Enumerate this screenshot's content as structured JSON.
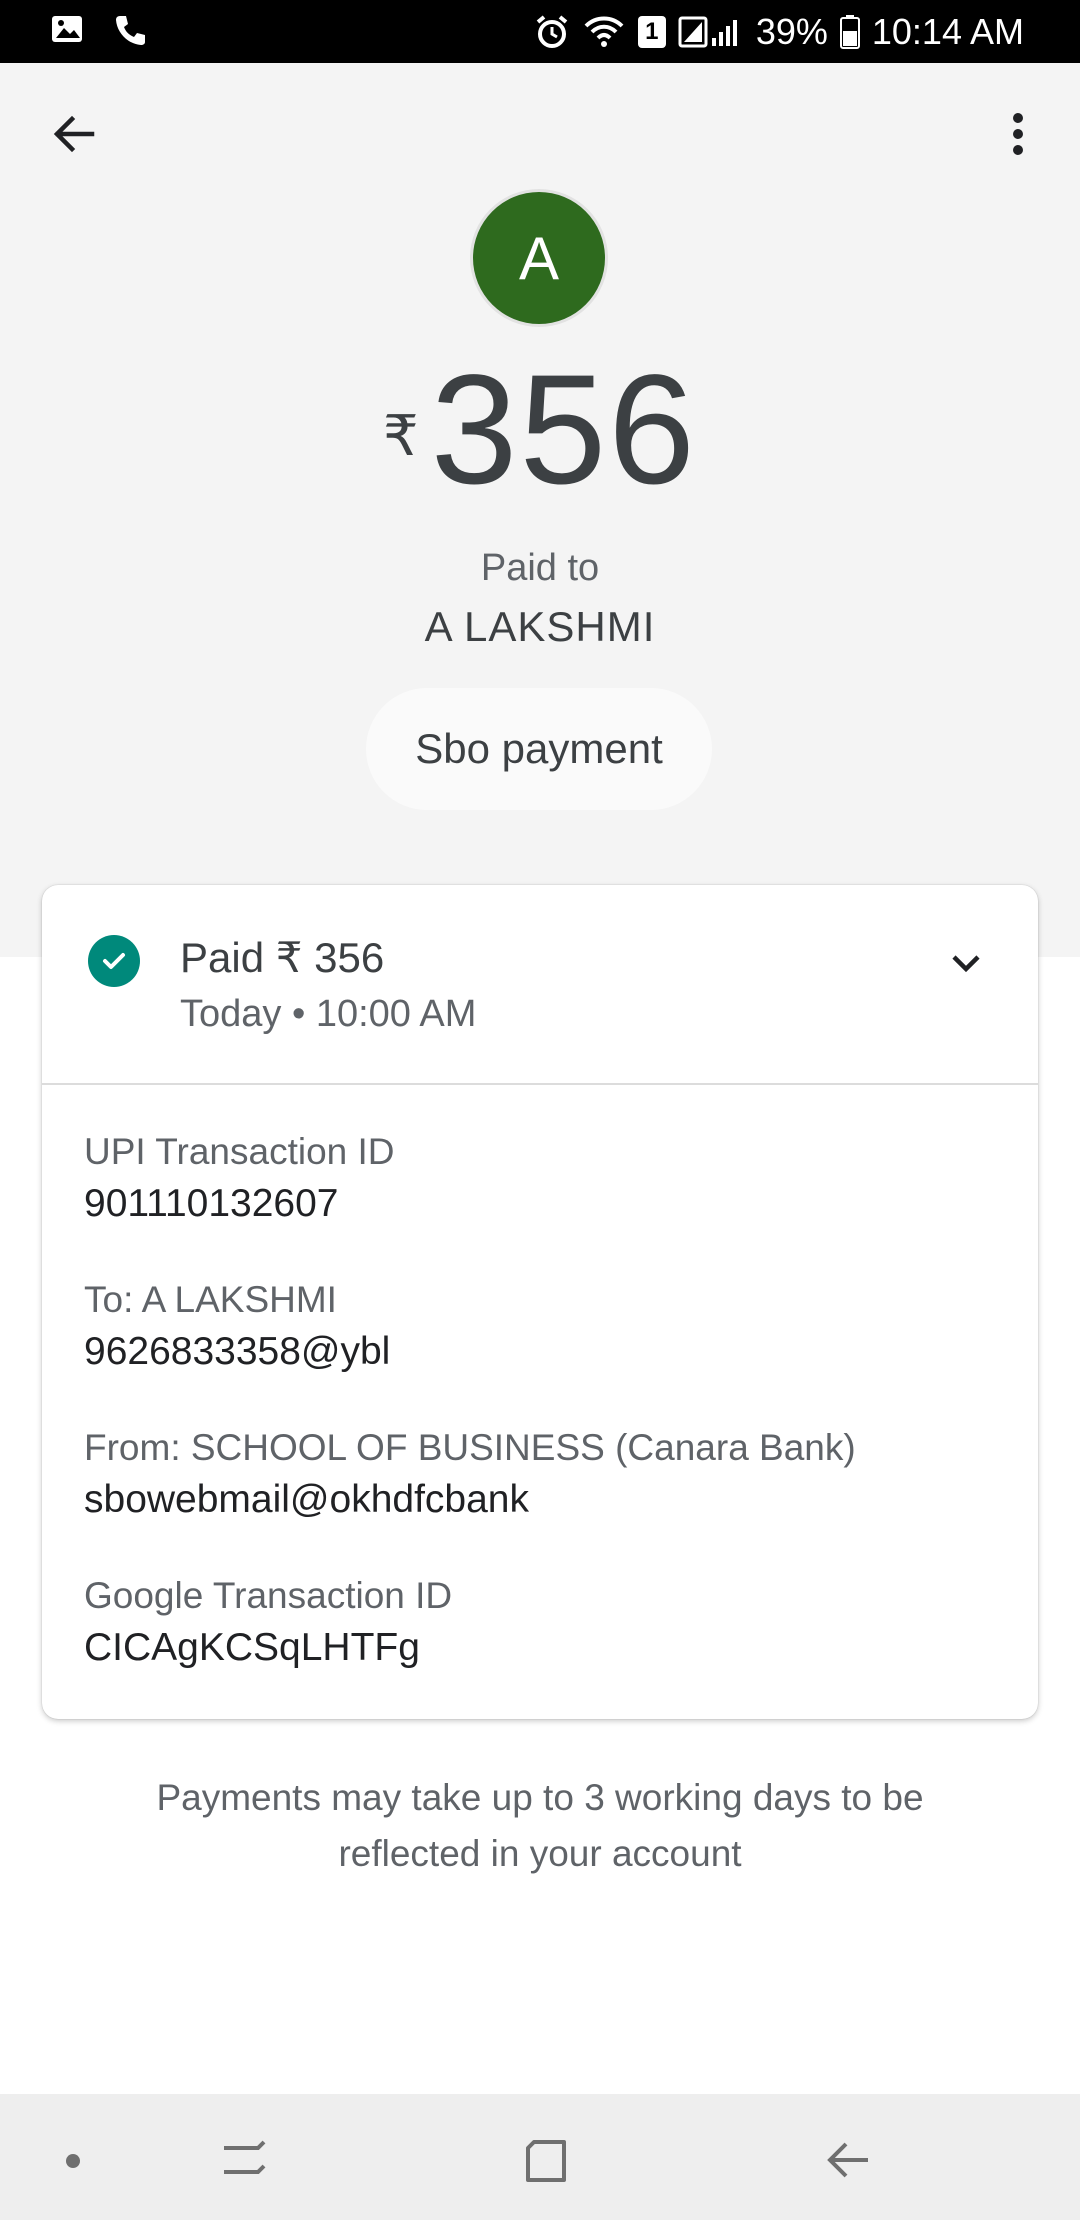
{
  "status_bar": {
    "battery": "39%",
    "time": "10:14 AM",
    "sim_badge": "1",
    "icons": [
      "gallery-icon",
      "call-icon",
      "alarm-icon",
      "wifi-icon",
      "signal-icon",
      "battery-icon"
    ]
  },
  "header": {
    "avatar_letter": "A",
    "avatar_color": "#2e6a1e",
    "currency_symbol": "₹",
    "amount": "356",
    "paid_to_label": "Paid to",
    "payee_name": "A LAKSHMI",
    "note": "Sbo payment"
  },
  "status_card": {
    "status": "Paid ₹ 356",
    "time": "Today • 10:00 AM",
    "status_color": "#00897b"
  },
  "details": [
    {
      "label": "UPI Transaction ID",
      "value": "901110132607"
    },
    {
      "label": "To: A LAKSHMI",
      "value": "9626833358@ybl"
    },
    {
      "label": "From: SCHOOL OF BUSINESS (Canara Bank)",
      "value": "sbowebmail@okhdfcbank"
    },
    {
      "label": "Google Transaction ID",
      "value": "CICAgKCSqLHTFg"
    }
  ],
  "footnote": "Payments may take up to 3 working days to be reflected in your account",
  "nav": {
    "items": [
      "dot-icon",
      "recent-apps-icon",
      "home-icon",
      "back-nav-icon"
    ]
  }
}
